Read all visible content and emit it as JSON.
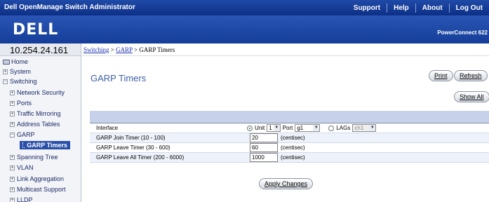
{
  "topbar": {
    "title": "Dell OpenManage Switch Administrator",
    "links": [
      "Support",
      "Help",
      "About",
      "Log Out"
    ]
  },
  "brand": {
    "logo": "DELL",
    "product": "PowerConnect 622"
  },
  "ip_address": "10.254.24.161",
  "breadcrumb": {
    "switching": "Switching",
    "sep1": ">",
    "garp": "GARP",
    "sep2": ">",
    "current": "GARP Timers"
  },
  "sidebar": {
    "items": [
      {
        "label": "Home"
      },
      {
        "label": "System",
        "toggle": "+"
      },
      {
        "label": "Switching",
        "toggle": "−"
      },
      {
        "label": "Network Security",
        "toggle": "+"
      },
      {
        "label": "Ports",
        "toggle": "+"
      },
      {
        "label": "Traffic Mirroring",
        "toggle": "+"
      },
      {
        "label": "Address Tables",
        "toggle": "+"
      },
      {
        "label": "GARP",
        "toggle": "−"
      },
      {
        "label": "GARP Timers"
      },
      {
        "label": "Spanning Tree",
        "toggle": "+"
      },
      {
        "label": "VLAN",
        "toggle": "+"
      },
      {
        "label": "Link Aggregation",
        "toggle": "+"
      },
      {
        "label": "Multicast Support",
        "toggle": "+"
      },
      {
        "label": "LLDP",
        "toggle": "+"
      }
    ]
  },
  "main": {
    "title": "GARP Timers",
    "print_label": "Print",
    "refresh_label": "Refresh",
    "show_all_label": "Show All",
    "apply_label": "Apply Changes",
    "interface": {
      "label": "Interface",
      "unit_label": "Unit",
      "unit_value": "1",
      "port_label": "Port",
      "port_value": "g1",
      "lags_label": "LAGs",
      "lags_value": "ch1"
    },
    "rows": [
      {
        "label": "GARP Join Timer (10 - 100)",
        "value": "20",
        "unit": "(centisec)"
      },
      {
        "label": "GARP Leave Timer (30 - 600)",
        "value": "60",
        "unit": "(centisec)"
      },
      {
        "label": "GARP Leave All Timer (200 - 6000)",
        "value": "1000",
        "unit": "(centisec)"
      }
    ]
  },
  "colors": {
    "topbar": "#1f4aa8",
    "title": "#3d5fa7",
    "active_nav": "#2a4fa8",
    "panel_head": "#c7d2ea"
  }
}
